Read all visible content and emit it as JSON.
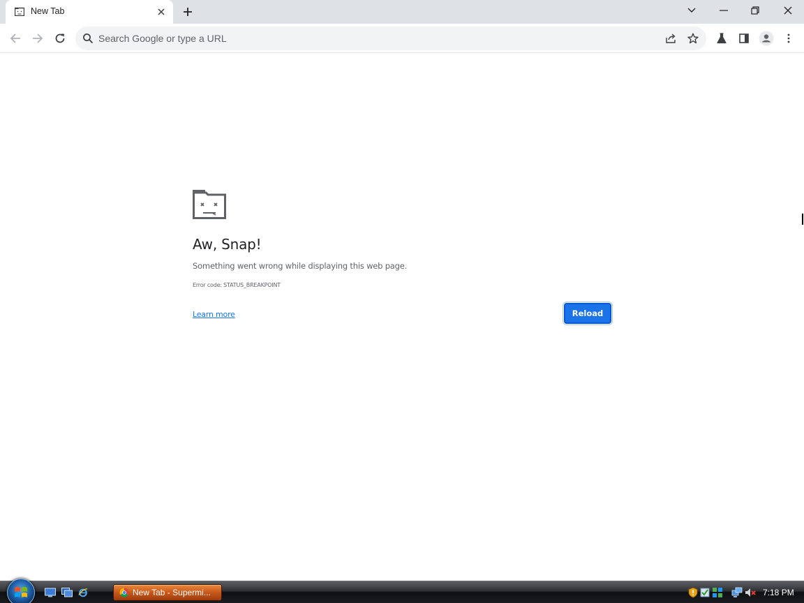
{
  "browser": {
    "tab": {
      "title": "New Tab"
    },
    "omnibox": {
      "placeholder": "Search Google or type a URL"
    }
  },
  "error_page": {
    "heading": "Aw, Snap!",
    "message": "Something went wrong while displaying this web page.",
    "error_code": "Error code: STATUS_BREAKPOINT",
    "learn_more": "Learn more",
    "reload": "Reload"
  },
  "taskbar": {
    "task_button": "New Tab - Supermi...",
    "clock": "7:18 PM"
  },
  "colors": {
    "accent": "#1a73e8",
    "tabstrip": "#dee1e6",
    "omnibox": "#f1f3f4"
  }
}
